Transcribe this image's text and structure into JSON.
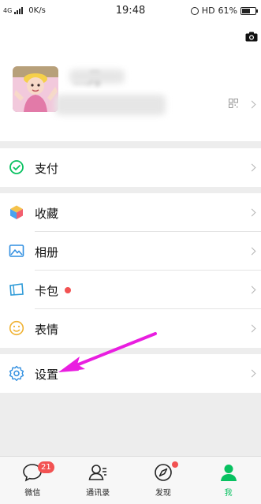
{
  "status_bar": {
    "network": "4G",
    "speed": "0K/s",
    "time": "19:48",
    "hd": "HD",
    "battery": "61%",
    "battery_level": 0.61
  },
  "profile": {
    "nickname": "…月"
  },
  "menu": {
    "pay": "支付",
    "favorites": "收藏",
    "album": "相册",
    "cards": "卡包",
    "stickers": "表情",
    "settings": "设置"
  },
  "tabbar": {
    "chats": "微信",
    "chats_badge": "21",
    "contacts": "通讯录",
    "discover": "发现",
    "me": "我"
  },
  "colors": {
    "accent": "#07c160",
    "badge": "#f25252",
    "arrow": "#e91ee0"
  },
  "icons": [
    "camera-icon",
    "qr-code-icon",
    "pay-icon",
    "favorites-icon",
    "album-icon",
    "cards-icon",
    "stickers-icon",
    "settings-icon",
    "chats-icon",
    "contacts-icon",
    "discover-icon",
    "me-icon"
  ]
}
